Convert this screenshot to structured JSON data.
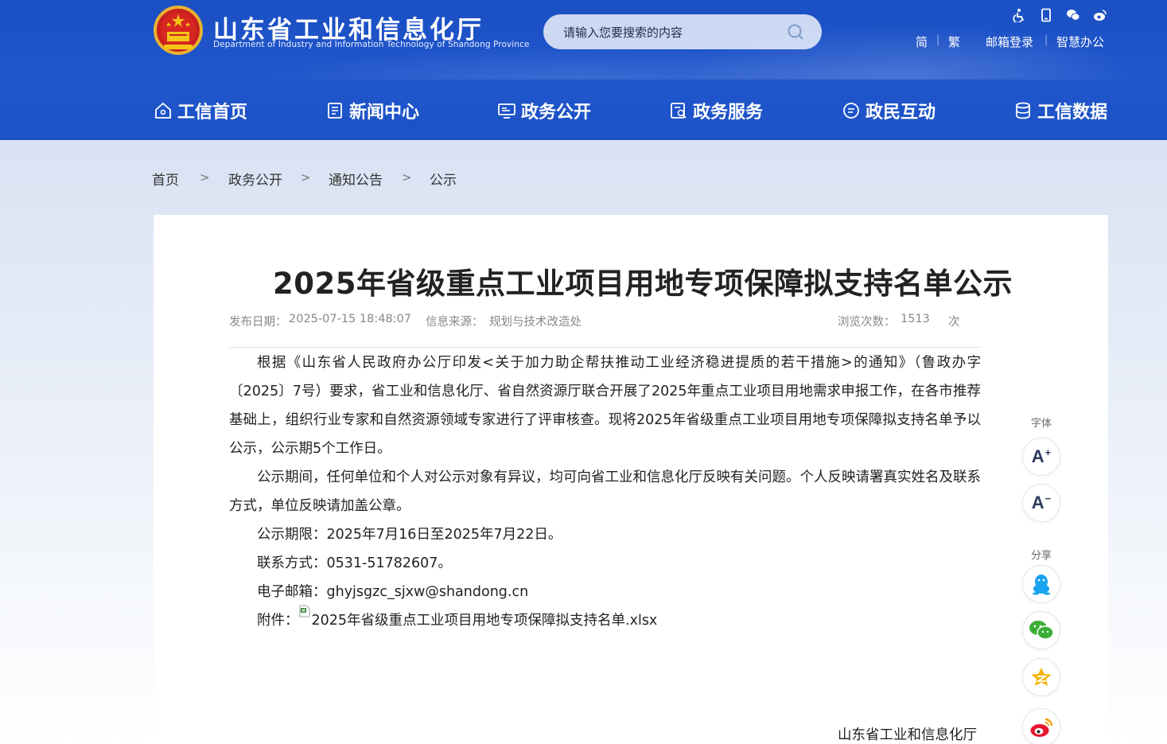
{
  "header": {
    "site_title": "山东省工业和信息化厅",
    "site_subtitle": "Department of Industry and Information Technology of Shandong Province",
    "search_placeholder": "请输入您要搜索的内容",
    "top_icons": [
      "accessibility-icon",
      "mobile-icon",
      "wechat-icon",
      "weibo-icon"
    ],
    "links": {
      "simplified": "简",
      "traditional": "繁",
      "mail_login": "邮箱登录",
      "smart_office": "智慧办公",
      "separator": "|"
    }
  },
  "nav": {
    "items": [
      {
        "label": "工信首页",
        "icon": "home-icon"
      },
      {
        "label": "新闻中心",
        "icon": "news-icon"
      },
      {
        "label": "政务公开",
        "icon": "monitor-icon"
      },
      {
        "label": "政务服务",
        "icon": "service-icon"
      },
      {
        "label": "政民互动",
        "icon": "chat-icon"
      },
      {
        "label": "工信数据",
        "icon": "database-icon"
      }
    ]
  },
  "breadcrumb": {
    "items": [
      "首页",
      "政务公开",
      "通知公告",
      "公示"
    ],
    "separator": ">"
  },
  "article": {
    "title": "2025年省级重点工业项目用地专项保障拟支持名单公示",
    "meta": {
      "date_label": "发布日期：",
      "date": "2025-07-15 18:48:07",
      "source_label": "信息来源：",
      "source": "规划与技术改造处",
      "views_label": "浏览次数：",
      "views": "1513",
      "views_unit": "次"
    },
    "paragraphs": [
      "根据《山东省人民政府办公厅印发<关于加力助企帮扶推动工业经济稳进提质的若干措施>的通知》（鲁政办字〔2025〕7号）要求，省工业和信息化厅、省自然资源厅联合开展了2025年重点工业项目用地需求申报工作，在各市推荐基础上，组织行业专家和自然资源领域专家进行了评审核查。现将2025年省级重点工业项目用地专项保障拟支持名单予以公示，公示期5个工作日。",
      "公示期间，任何单位和个人对公示对象有异议，均可向省工业和信息化厅反映有关问题。个人反映请署真实姓名及联系方式，单位反映请加盖公章。"
    ],
    "period_line": "公示期限：2025年7月16日至2025年7月22日。",
    "contact_line": "联系方式：0531-51782607。",
    "email_line": "电子邮箱：ghyjsgzc_sjxw@shandong.cn",
    "attachment_label": "附件：",
    "attachment_name": "2025年省级重点工业项目用地专项保障拟支持名单.xlsx",
    "signature": "山东省工业和信息化厅"
  },
  "side_tools": {
    "font_label": "字体",
    "font_increase": "A",
    "font_increase_mark": "+",
    "font_decrease": "A",
    "font_decrease_mark": "−",
    "share_label": "分享",
    "share_icons": [
      "qq-icon",
      "wechat-share-icon",
      "qzone-icon",
      "weibo-share-icon"
    ]
  },
  "colors": {
    "header_blue": "#1d52c6",
    "accent_red": "#e53935"
  }
}
